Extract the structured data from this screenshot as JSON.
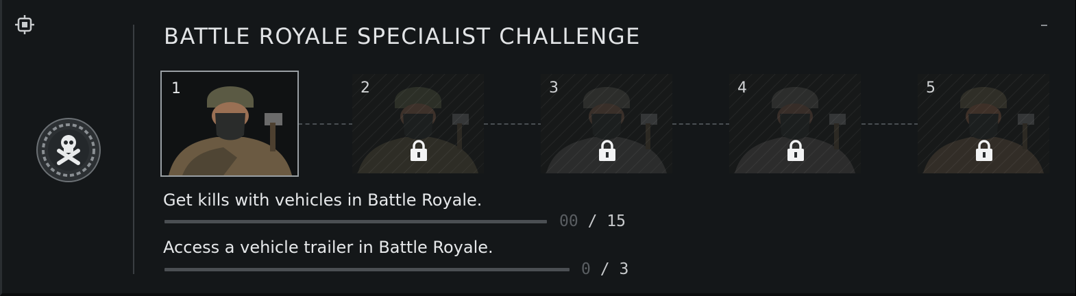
{
  "challenge": {
    "title": "BATTLE ROYALE SPECIALIST CHALLENGE",
    "emblem_icon": "skull-crossbones-laurel-icon",
    "pin_icon": "pin-target-icon",
    "minimize_icon": "minimize-icon"
  },
  "tiers": [
    {
      "number": "1",
      "state": "unlocked"
    },
    {
      "number": "2",
      "state": "locked"
    },
    {
      "number": "3",
      "state": "locked"
    },
    {
      "number": "4",
      "state": "locked"
    },
    {
      "number": "5",
      "state": "locked"
    }
  ],
  "tasks": [
    {
      "text": "Get kills with vehicles in Battle Royale.",
      "current": "00",
      "separator": "/",
      "target": "15",
      "progress": 0
    },
    {
      "text": "Access a vehicle trailer in Battle Royale.",
      "current": "0",
      "separator": "/",
      "target": "3",
      "progress": 0
    }
  ],
  "colors": {
    "background": "#141719",
    "text": "#e2e4e6",
    "accent_border": "#9aa0a4",
    "progress_track": "#4b4f53",
    "muted_value": "#5a5e62"
  }
}
